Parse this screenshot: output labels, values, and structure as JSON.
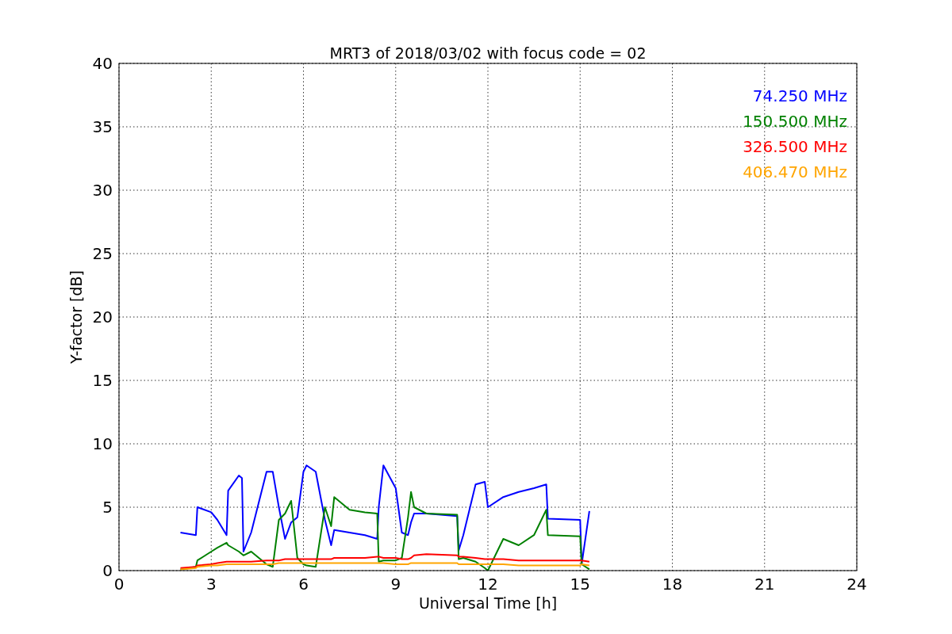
{
  "chart_data": {
    "type": "line",
    "title": "MRT3 of 2018/03/02 with focus code = 02",
    "xlabel": "Universal Time [h]",
    "ylabel": "Y-factor [dB]",
    "xlim": [
      0,
      24
    ],
    "ylim": [
      0,
      40
    ],
    "xticks": [
      0,
      3,
      6,
      9,
      12,
      15,
      18,
      21,
      24
    ],
    "yticks": [
      0,
      5,
      10,
      15,
      20,
      25,
      30,
      35,
      40
    ],
    "grid": true,
    "x": [
      2.0,
      2.5,
      2.55,
      3.0,
      3.2,
      3.5,
      3.55,
      3.9,
      4.0,
      4.05,
      4.3,
      4.8,
      5.0,
      5.2,
      5.4,
      5.6,
      5.8,
      6.0,
      6.1,
      6.4,
      6.7,
      6.9,
      7.0,
      7.5,
      8.0,
      8.4,
      8.45,
      8.6,
      9.0,
      9.2,
      9.4,
      9.5,
      9.6,
      10.0,
      11.0,
      11.05,
      11.2,
      11.6,
      11.9,
      12.0,
      12.5,
      13.0,
      13.5,
      13.9,
      13.95,
      15.0,
      15.05,
      15.3
    ],
    "series": [
      {
        "name": "74.250 MHz",
        "color": "#0000ff",
        "values": [
          3.0,
          2.8,
          5.0,
          4.6,
          4.0,
          2.8,
          6.3,
          7.5,
          7.3,
          1.5,
          3.0,
          7.8,
          7.8,
          5.0,
          2.5,
          3.8,
          4.2,
          7.8,
          8.3,
          7.8,
          4.0,
          2.0,
          3.2,
          3.0,
          2.8,
          2.5,
          5.0,
          8.3,
          6.5,
          3.0,
          2.8,
          3.8,
          4.5,
          4.5,
          4.3,
          1.6,
          2.8,
          6.8,
          7.0,
          5.0,
          5.8,
          6.2,
          6.5,
          6.8,
          4.1,
          4.0,
          0.5,
          4.7
        ]
      },
      {
        "name": "150.500 MHz",
        "color": "#008000",
        "values": [
          0.1,
          0.3,
          0.8,
          1.5,
          1.8,
          2.2,
          2.0,
          1.5,
          1.3,
          1.2,
          1.5,
          0.5,
          0.3,
          4.0,
          4.5,
          5.5,
          1.0,
          0.5,
          0.4,
          0.3,
          5.0,
          3.5,
          5.8,
          4.8,
          4.6,
          4.5,
          0.7,
          0.8,
          0.8,
          1.0,
          4.2,
          6.2,
          5.0,
          4.5,
          4.4,
          0.9,
          1.0,
          0.7,
          0.2,
          0.0,
          2.5,
          2.0,
          2.8,
          4.8,
          2.8,
          2.7,
          0.5,
          0.1
        ]
      },
      {
        "name": "326.500 MHz",
        "color": "#ff0000",
        "values": [
          0.2,
          0.3,
          0.4,
          0.5,
          0.6,
          0.7,
          0.7,
          0.7,
          0.7,
          0.7,
          0.7,
          0.8,
          0.8,
          0.8,
          0.9,
          0.9,
          0.9,
          0.9,
          0.9,
          0.9,
          0.9,
          0.9,
          1.0,
          1.0,
          1.0,
          1.1,
          1.1,
          1.0,
          1.0,
          0.9,
          0.9,
          1.0,
          1.2,
          1.3,
          1.2,
          1.1,
          1.1,
          1.0,
          0.9,
          0.9,
          0.9,
          0.8,
          0.8,
          0.8,
          0.8,
          0.8,
          0.8,
          0.7
        ]
      },
      {
        "name": "406.470 MHz",
        "color": "#ffa500",
        "values": [
          0.1,
          0.2,
          0.3,
          0.4,
          0.4,
          0.5,
          0.5,
          0.5,
          0.5,
          0.5,
          0.5,
          0.5,
          0.5,
          0.6,
          0.6,
          0.6,
          0.6,
          0.6,
          0.6,
          0.6,
          0.6,
          0.6,
          0.6,
          0.6,
          0.6,
          0.6,
          0.6,
          0.6,
          0.5,
          0.5,
          0.5,
          0.6,
          0.6,
          0.6,
          0.6,
          0.5,
          0.5,
          0.5,
          0.5,
          0.5,
          0.5,
          0.4,
          0.4,
          0.4,
          0.4,
          0.4,
          0.5,
          0.4
        ]
      }
    ]
  }
}
